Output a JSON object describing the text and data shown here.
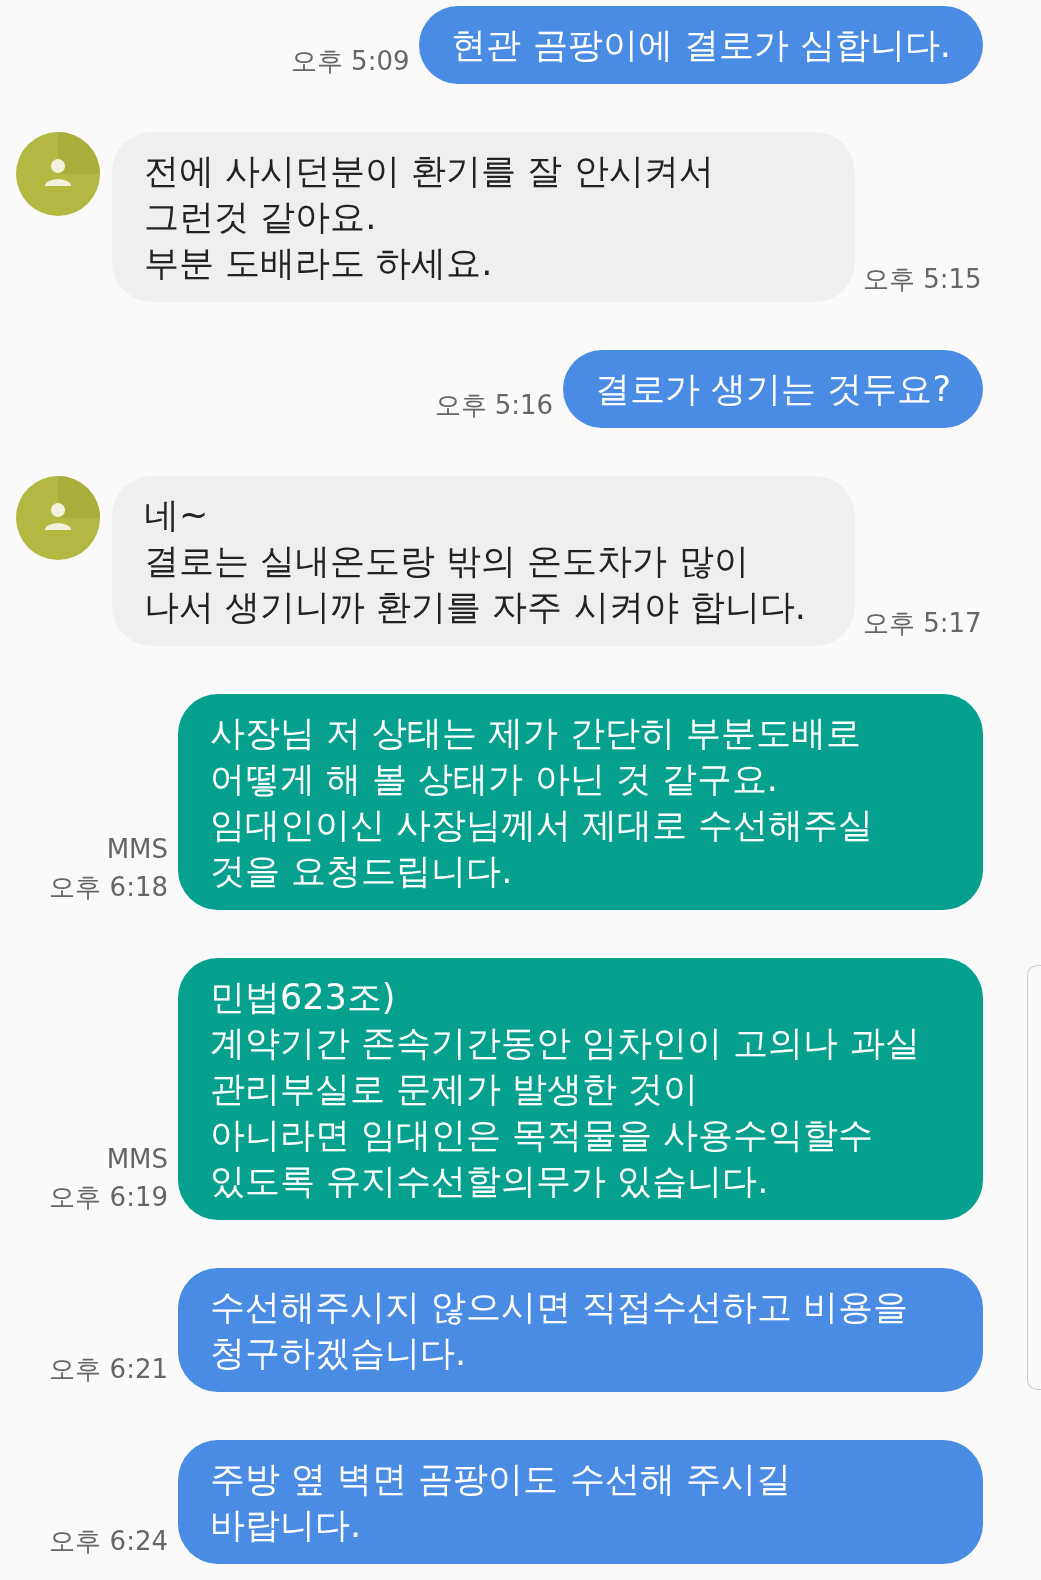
{
  "messages": [
    {
      "kind": "sent",
      "time": "오후 5:09",
      "lines": [
        "현관 곰팡이에 결로가 심합니다."
      ]
    },
    {
      "kind": "received",
      "time": "오후 5:15",
      "lines": [
        "전에 사시던분이 환기를 잘 안시켜서",
        "그런것 같아요.",
        "부분 도배라도 하세요."
      ]
    },
    {
      "kind": "sent",
      "time": "오후 5:16",
      "lines": [
        "결로가 생기는 것두요?"
      ]
    },
    {
      "kind": "received",
      "time": "오후 5:17",
      "lines": [
        "네~",
        "결로는 실내온도랑 밖의 온도차가 많이",
        "나서 생기니까 환기를 자주 시켜야 합니다."
      ]
    },
    {
      "kind": "mms",
      "label": "MMS",
      "time": "오후 6:18",
      "lines": [
        "사장님 저 상태는 제가 간단히 부분도배로",
        "어떻게 해 볼 상태가 아닌 것 같구요.",
        "임대인이신 사장님께서 제대로 수선해주실",
        "것을 요청드립니다."
      ]
    },
    {
      "kind": "mms",
      "label": "MMS",
      "time": "오후 6:19",
      "lines": [
        "민법623조)",
        "계약기간 존속기간동안 임차인이 고의나 과실",
        "관리부실로 문제가 발생한 것이",
        "아니라면 임대인은 목적물을 사용수익할수",
        "있도록 유지수선할의무가 있습니다."
      ]
    },
    {
      "kind": "sent",
      "time": "오후 6:21",
      "lines": [
        "수선해주시지 않으시면 직접수선하고 비용을",
        "청구하겠습니다."
      ]
    },
    {
      "kind": "sent",
      "time": "오후 6:24",
      "lines": [
        "주방 옆  벽면 곰팡이도 수선해 주시길",
        "바랍니다."
      ]
    }
  ]
}
